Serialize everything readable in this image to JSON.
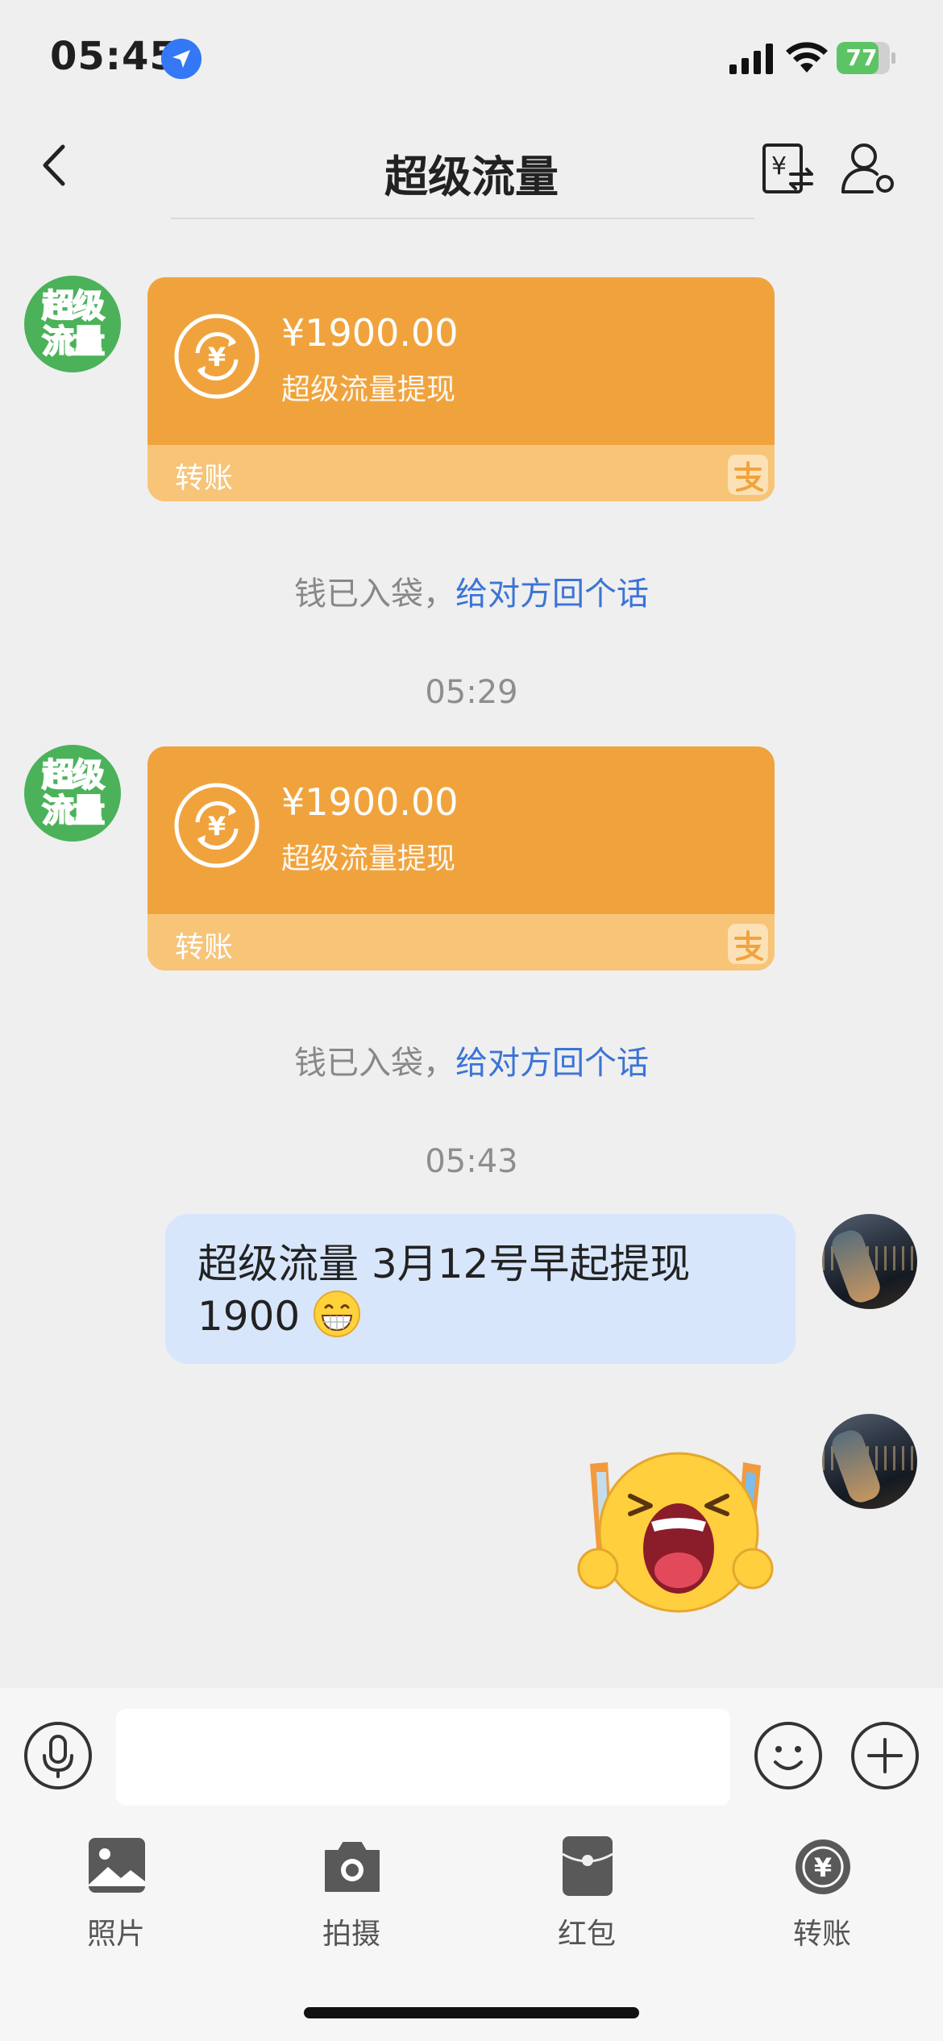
{
  "status_bar": {
    "time": "05:45",
    "battery": "77"
  },
  "header": {
    "title": "超级流量"
  },
  "contact": {
    "avatar_lines": [
      "超级",
      "流量"
    ]
  },
  "messages": [
    {
      "amount": "¥1900.00",
      "desc": "超级流量提现",
      "label": "转账",
      "note_prefix": "钱已入袋，",
      "note_link": "给对方回个话"
    },
    {
      "amount": "¥1900.00",
      "desc": "超级流量提现",
      "label": "转账",
      "note_prefix": "钱已入袋，",
      "note_link": "给对方回个话"
    }
  ],
  "timestamps": [
    "05:29",
    "05:43"
  ],
  "my_message": {
    "line1": "超级流量 3月12号早起提现",
    "line2": "1900"
  },
  "input": {
    "placeholder": ""
  },
  "toolbar": [
    {
      "label": "照片",
      "icon": "photo-icon"
    },
    {
      "label": "拍摄",
      "icon": "camera-icon"
    },
    {
      "label": "红包",
      "icon": "red-packet-icon"
    },
    {
      "label": "转账",
      "icon": "transfer-icon"
    }
  ],
  "colors": {
    "transfer_card": "#f0a33d",
    "transfer_footer": "#f7c478",
    "link": "#3b74d6",
    "my_bubble": "#d8e6fb"
  }
}
